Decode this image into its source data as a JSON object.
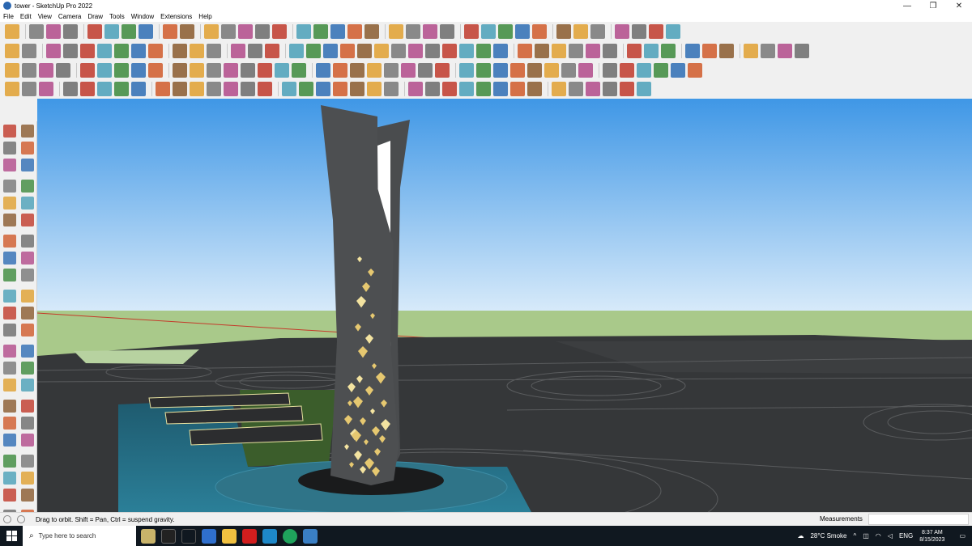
{
  "window": {
    "title": "tower - SketchUp Pro 2022",
    "min": "—",
    "max": "❐",
    "close": "✕"
  },
  "menu": [
    "File",
    "Edit",
    "View",
    "Camera",
    "Draw",
    "Tools",
    "Window",
    "Extensions",
    "Help"
  ],
  "status": {
    "message": "Drag to orbit. Shift = Pan, Ctrl = suspend gravity.",
    "measurements_label": "Measurements",
    "measurements_value": ""
  },
  "taskbar": {
    "search_placeholder": "Type here to search",
    "weather": "28°C  Smoke",
    "language": "ENG",
    "time": "8:37 AM",
    "date": "8/15/2023"
  },
  "colors": {
    "sky_top": "#4f9ee2",
    "sky_bottom": "#cfe4f7",
    "ground": "#a9c98a",
    "accent": "#0078d7"
  }
}
